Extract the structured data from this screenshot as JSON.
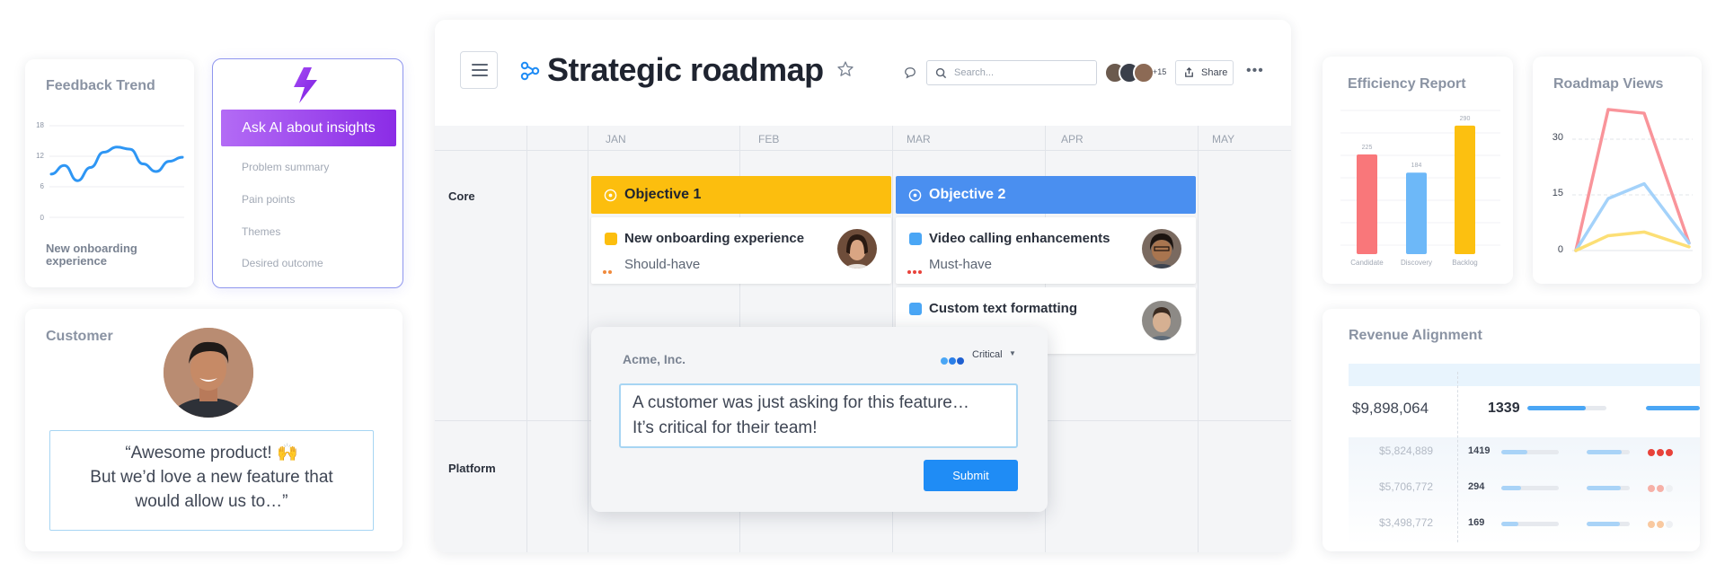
{
  "feedback_trend": {
    "title": "Feedback Trend",
    "y_ticks": [
      "18",
      "12",
      "6",
      "0"
    ],
    "caption": "New onboarding experience",
    "chart_data": {
      "type": "line",
      "ylim": [
        0,
        18
      ],
      "x": [
        0,
        1,
        2,
        3,
        4,
        5,
        6,
        7,
        8,
        9,
        10
      ],
      "values": [
        8.5,
        10.2,
        7.2,
        9.8,
        12.8,
        13.8,
        13.4,
        10.5,
        9.0,
        11.0,
        11.8
      ]
    }
  },
  "ai_panel": {
    "button_label": "Ask AI about insights",
    "items": [
      "Problem summary",
      "Pain points",
      "Themes",
      "Desired outcome"
    ]
  },
  "customer": {
    "title": "Customer",
    "quote_line1": "“Awesome product! 🙌",
    "quote_line2": "But we’d love a new feature that",
    "quote_line3": "would allow us to…”"
  },
  "roadmap": {
    "title": "Strategic roadmap",
    "search_placeholder": "Search...",
    "collaborators_more": "+15",
    "share_label": "Share",
    "months": [
      "JAN",
      "FEB",
      "MAR",
      "APR",
      "MAY"
    ],
    "lanes": [
      "Core",
      "Platform"
    ],
    "objectives": [
      {
        "label": "Objective 1",
        "color": "#fcbe0e"
      },
      {
        "label": "Objective 2",
        "color": "#4a8ff0"
      }
    ],
    "features": [
      {
        "name": "New onboarding experience",
        "priority": "Should-have",
        "square": "#fcbe0e",
        "dot": "#f08a3c"
      },
      {
        "name": "Video calling enhancements",
        "priority": "Must-have",
        "square": "#4aa6f5",
        "dot": "#e8423a"
      },
      {
        "name": "Custom text formatting",
        "priority": "",
        "square": "#4aa6f5",
        "dot": ""
      }
    ]
  },
  "feedback_popup": {
    "company": "Acme, Inc.",
    "importance": "Critical",
    "message_line1": "A customer was just asking for this feature…",
    "message_line2": "It’s critical for their team!",
    "submit_label": "Submit"
  },
  "efficiency": {
    "title": "Efficiency Report",
    "chart_data": {
      "type": "bar",
      "categories": [
        "Candidate",
        "Discovery",
        "Backlog"
      ],
      "values": [
        225,
        184,
        290
      ],
      "colors": [
        "#f9777a",
        "#6db8f8",
        "#fcc010"
      ]
    }
  },
  "views": {
    "title": "Roadmap Views",
    "y_ticks": [
      "30",
      "15",
      "0"
    ],
    "chart_data": {
      "type": "line",
      "ylim": [
        0,
        40
      ],
      "x": [
        0,
        1,
        2,
        3
      ],
      "series": [
        {
          "color": "#f9949a",
          "values": [
            0,
            38,
            37,
            2
          ]
        },
        {
          "color": "#a4d2fa",
          "values": [
            0,
            14,
            18,
            2
          ]
        },
        {
          "color": "#fcdf75",
          "values": [
            0,
            4,
            5,
            1
          ]
        }
      ]
    }
  },
  "revenue": {
    "title": "Revenue Alignment",
    "top_row": {
      "amount": "$9,898,064",
      "count": "1339",
      "fill": 0.74
    },
    "rows": [
      {
        "amount": "$5,824,889",
        "count": "1419",
        "fill": 0.45,
        "dots": [
          "#e8423a",
          "#e8423a",
          "#e8423a"
        ]
      },
      {
        "amount": "$5,706,772",
        "count": "294",
        "fill": 0.35,
        "dots": [
          "#f6b0a7",
          "#f6b0a7",
          "#eef0f3"
        ]
      },
      {
        "amount": "$3,498,772",
        "count": "169",
        "fill": 0.3,
        "dots": [
          "#f9c9a0",
          "#f9c9a0",
          "#eef0f3"
        ]
      }
    ]
  }
}
